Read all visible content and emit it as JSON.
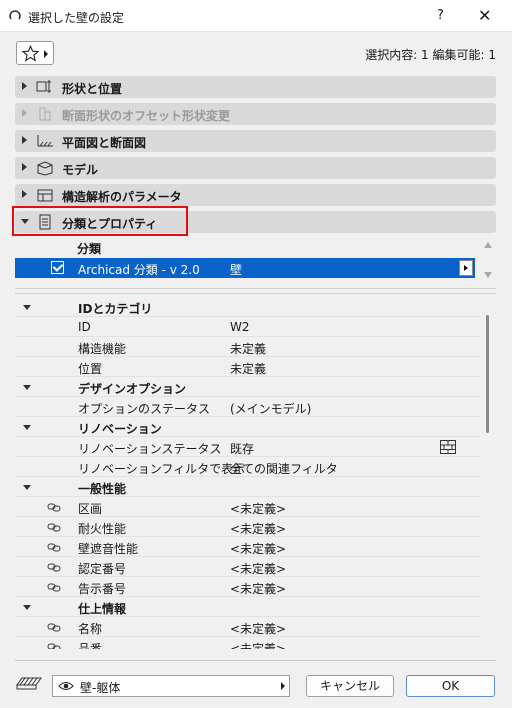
{
  "window": {
    "title": "選択した壁の設定",
    "help": "?",
    "close": "✕"
  },
  "toolbar": {
    "favorites_icon": "star-icon",
    "selection_info": "選択内容: 1 編集可能: 1"
  },
  "sections": [
    {
      "label": "形状と位置",
      "icon": "geometry-icon",
      "expanded": false,
      "enabled": true
    },
    {
      "label": "断面形状のオフセット形状変更",
      "icon": "profile-offset-icon",
      "expanded": false,
      "enabled": false
    },
    {
      "label": "平面図と断面図",
      "icon": "floorplan-icon",
      "expanded": false,
      "enabled": true
    },
    {
      "label": "モデル",
      "icon": "model-icon",
      "expanded": false,
      "enabled": true
    },
    {
      "label": "構造解析のパラメータ",
      "icon": "structural-icon",
      "expanded": false,
      "enabled": true
    },
    {
      "label": "分類とプロパティ",
      "icon": "properties-icon",
      "expanded": true,
      "enabled": true
    }
  ],
  "classification": {
    "header": "分類",
    "row": {
      "name": "Archicad 分類 - v 2.0",
      "value": "壁",
      "checked": true
    }
  },
  "properties": {
    "groups": [
      {
        "label": "IDとカテゴリ",
        "rows": [
          {
            "label": "ID",
            "value": "W2"
          },
          {
            "label": "構造機能",
            "value": "未定義"
          },
          {
            "label": "位置",
            "value": "未定義"
          }
        ]
      },
      {
        "label": "デザインオプション",
        "rows": [
          {
            "label": "オプションのステータス",
            "value": "(メインモデル)"
          }
        ]
      },
      {
        "label": "リノベーション",
        "rows": [
          {
            "label": "リノベーションステータス",
            "value": "既存",
            "extra_icon": "brick-wall-icon"
          },
          {
            "label": "リノベーションフィルタで表示",
            "value": "全ての関連フィルタ"
          }
        ]
      },
      {
        "label": "一般性能",
        "rows": [
          {
            "label": "区画",
            "value": "<未定義>",
            "linked": true
          },
          {
            "label": "耐火性能",
            "value": "<未定義>",
            "linked": true
          },
          {
            "label": "壁遮音性能",
            "value": "<未定義>",
            "linked": true
          },
          {
            "label": "認定番号",
            "value": "<未定義>",
            "linked": true
          },
          {
            "label": "告示番号",
            "value": "<未定義>",
            "linked": true
          }
        ]
      },
      {
        "label": "仕上情報",
        "rows": [
          {
            "label": "名称",
            "value": "<未定義>",
            "linked": true
          },
          {
            "label": "品番",
            "value": "<未定義>",
            "linked": true
          }
        ]
      }
    ]
  },
  "footer": {
    "layer_icon": "layer-icon",
    "layer_value": "壁-躯体",
    "cancel_label": "キャンセル",
    "ok_label": "OK"
  },
  "colors": {
    "selection_blue": "#0a63c9",
    "highlight_red": "#e01010",
    "section_gray": "#d9d9d9"
  }
}
